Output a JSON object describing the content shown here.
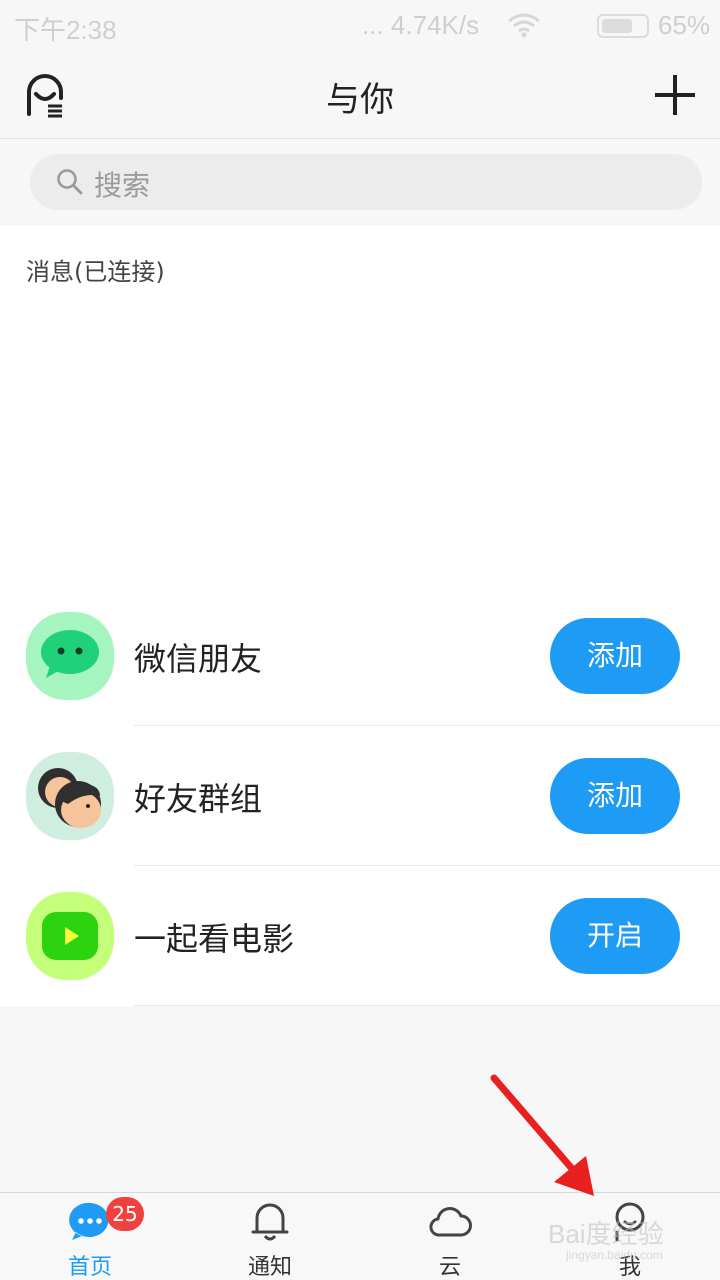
{
  "status_bar": {
    "time": "下午2:38",
    "network_speed": "... 4.74K/s",
    "battery": "65%",
    "battery_level": 0.65
  },
  "header": {
    "title": "与你",
    "left_icon": "user-menu-icon",
    "right_icon": "plus-icon"
  },
  "search": {
    "placeholder": "搜索",
    "icon": "search-icon"
  },
  "section": {
    "label": "消息(已连接)"
  },
  "items": [
    {
      "name": "微信朋友",
      "button": "添加",
      "icon": "wechat-icon",
      "icon_bg": "#a6f4c0"
    },
    {
      "name": "好友群组",
      "button": "添加",
      "icon": "friends-group-icon",
      "icon_bg": "#cfeee0"
    },
    {
      "name": "一起看电影",
      "button": "开启",
      "icon": "movie-play-icon",
      "icon_bg": "#c5ff7a"
    }
  ],
  "tabbar": {
    "tabs": [
      {
        "label": "首页",
        "icon": "chat-bubble-icon",
        "active": true,
        "badge": "25"
      },
      {
        "label": "通知",
        "icon": "bell-icon",
        "active": false
      },
      {
        "label": "云",
        "icon": "cloud-icon",
        "active": false
      },
      {
        "label": "我",
        "icon": "person-icon",
        "active": false
      }
    ]
  },
  "overlay": {
    "watermark": "Bai度经验",
    "watermark_sub": "jingyan.baidu.com"
  },
  "colors": {
    "accent": "#1e9bf5",
    "badge": "#f0413e",
    "arrow": "#e82020"
  }
}
